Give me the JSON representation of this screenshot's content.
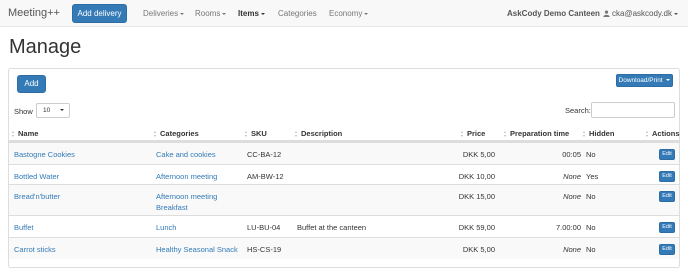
{
  "navbar": {
    "brand": "Meeting++",
    "add_delivery": "Add delivery",
    "items": [
      {
        "label": "Deliveries",
        "dropdown": true
      },
      {
        "label": "Rooms",
        "dropdown": true
      },
      {
        "label": "Items",
        "dropdown": true,
        "active": true
      },
      {
        "label": "Categories",
        "dropdown": false
      },
      {
        "label": "Economy",
        "dropdown": true
      }
    ],
    "company": "AskCody Demo Canteen",
    "user_email": "cka@askcody.dk"
  },
  "page": {
    "title": "Manage"
  },
  "toolbar": {
    "add_label": "Add",
    "download_label": "Download/Print"
  },
  "filters": {
    "show_label": "Show",
    "page_size": "10",
    "search_label": "Search:",
    "search_value": ""
  },
  "table": {
    "columns": [
      "Name",
      "Categories",
      "SKU",
      "Description",
      "Price",
      "Preparation time",
      "Hidden",
      "Actions"
    ],
    "rows": [
      {
        "name": "Bastogne Cookies",
        "categories": [
          "Cake and cookies"
        ],
        "sku": "CC-BA-12",
        "description": "",
        "price": "DKK 5,00",
        "prep_time": "00:05",
        "hidden": "No",
        "action": "Edit"
      },
      {
        "name": "Bottled Water",
        "categories": [
          "Afternoon meeting"
        ],
        "sku": "AM-BW-12",
        "description": "",
        "price": "DKK 10,00",
        "prep_time": "None",
        "hidden": "Yes",
        "action": "Edit"
      },
      {
        "name": "Bread'n'butter",
        "categories": [
          "Afternoon meeting",
          "Breakfast"
        ],
        "sku": "",
        "description": "",
        "price": "DKK 15,00",
        "prep_time": "None",
        "hidden": "No",
        "action": "Edit"
      },
      {
        "name": "Buffet",
        "categories": [
          "Lunch"
        ],
        "sku": "LU-BU-04",
        "description": "Buffet at the canteen",
        "price": "DKK 59,00",
        "prep_time": "7.00:00",
        "hidden": "No",
        "action": "Edit"
      },
      {
        "name": "Carrot sticks",
        "categories": [
          "Healthy Seasonal Snack"
        ],
        "sku": "HS-CS-19",
        "description": "",
        "price": "DKK 5,00",
        "prep_time": "None",
        "hidden": "No",
        "action": "Edit"
      }
    ]
  },
  "colors": {
    "primary": "#337ab7",
    "link": "#337ab7",
    "navbar_bg": "#f8f8f8"
  }
}
